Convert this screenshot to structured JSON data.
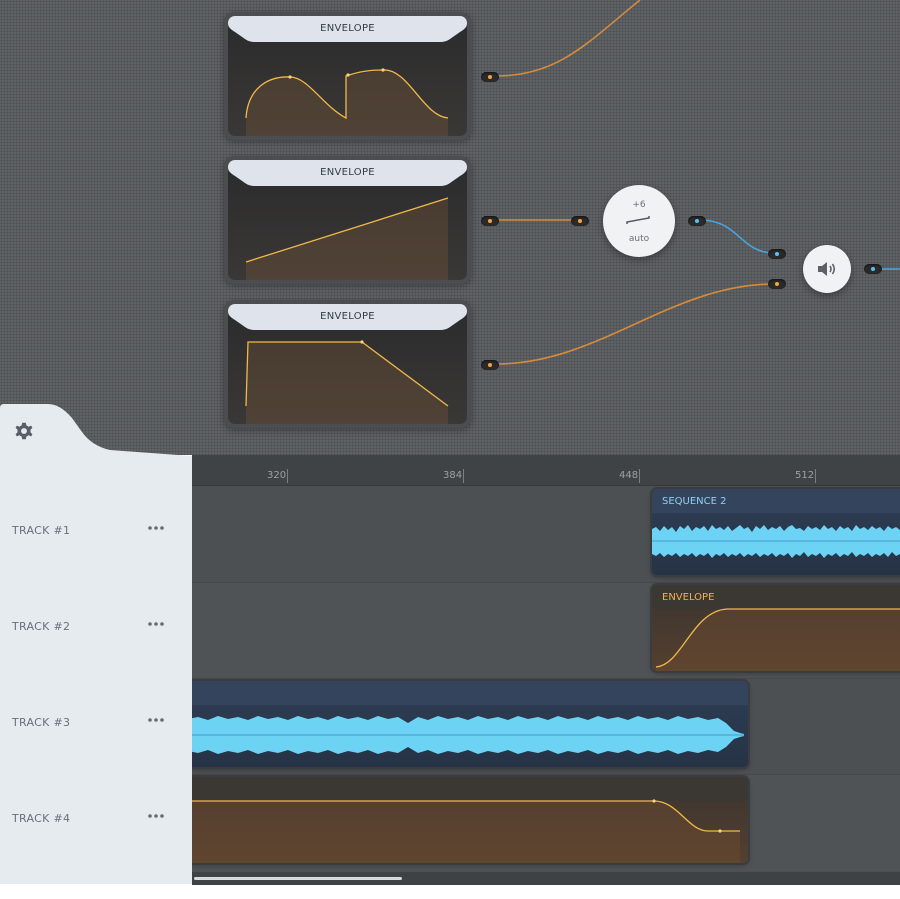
{
  "graph": {
    "envelopes": [
      {
        "title": "ENVELOPE"
      },
      {
        "title": "ENVELOPE"
      },
      {
        "title": "ENVELOPE"
      }
    ],
    "gain": {
      "value": "+6",
      "mode": "auto"
    },
    "output_icon": "speaker-icon",
    "colors": {
      "orange_wire": "#d68a3c",
      "blue_wire": "#4aa3dc",
      "envelope_line": "#f1b84a"
    }
  },
  "ruler": {
    "ticks": [
      "320",
      "384",
      "448",
      "512"
    ]
  },
  "tracks": [
    {
      "label": "TRACK #1",
      "more_icon": "more-icon"
    },
    {
      "label": "TRACK #2",
      "more_icon": "more-icon"
    },
    {
      "label": "TRACK #3",
      "more_icon": "more-icon"
    },
    {
      "label": "TRACK #4",
      "more_icon": "more-icon"
    }
  ],
  "clips": [
    {
      "title": "SEQUENCE 2",
      "kind": "audio"
    },
    {
      "title": "ENVELOPE",
      "kind": "envelope"
    },
    {
      "title": "",
      "kind": "audio"
    },
    {
      "title": "",
      "kind": "envelope"
    }
  ],
  "settings_icon": "gear-icon"
}
